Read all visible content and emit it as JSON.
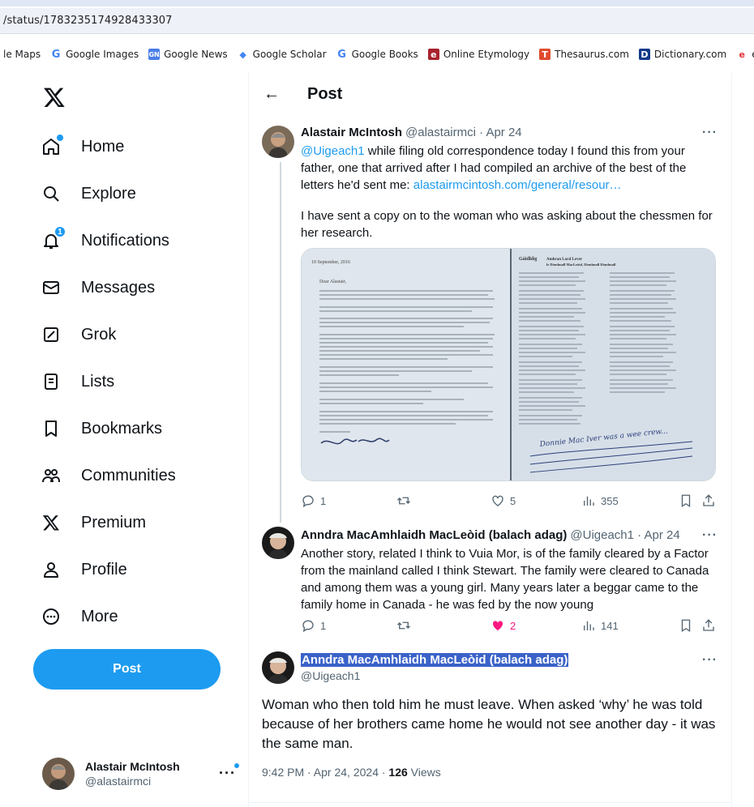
{
  "browser": {
    "url": "/status/1783235174928433307",
    "bookmarks": [
      {
        "label": "le Maps",
        "icon": "none"
      },
      {
        "label": "Google Images",
        "icon": "google-icon"
      },
      {
        "label": "Google News",
        "icon": "google-news-icon"
      },
      {
        "label": "Google Scholar",
        "icon": "google-scholar-icon"
      },
      {
        "label": "Google Books",
        "icon": "google-icon"
      },
      {
        "label": "Online Etymology",
        "icon": "etymology-icon"
      },
      {
        "label": "Thesaurus.com",
        "icon": "thesaurus-icon"
      },
      {
        "label": "Dictionary.com",
        "icon": "dictionary-icon"
      },
      {
        "label": "eBay",
        "icon": "ebay-icon"
      }
    ]
  },
  "nav": {
    "items": [
      {
        "label": "Home",
        "icon": "home-icon"
      },
      {
        "label": "Explore",
        "icon": "search-icon"
      },
      {
        "label": "Notifications",
        "icon": "bell-icon",
        "badge": "1"
      },
      {
        "label": "Messages",
        "icon": "envelope-icon"
      },
      {
        "label": "Grok",
        "icon": "grok-icon"
      },
      {
        "label": "Lists",
        "icon": "list-icon"
      },
      {
        "label": "Bookmarks",
        "icon": "bookmark-icon"
      },
      {
        "label": "Communities",
        "icon": "communities-icon"
      },
      {
        "label": "Premium",
        "icon": "x-logo-icon"
      },
      {
        "label": "Profile",
        "icon": "person-icon"
      },
      {
        "label": "More",
        "icon": "more-circle-icon"
      }
    ],
    "post_button": "Post"
  },
  "account": {
    "name": "Alastair McIntosh",
    "handle": "@alastairmci",
    "more": "···"
  },
  "header": {
    "title": "Post"
  },
  "tweet1": {
    "name": "Alastair McIntosh",
    "meta": "@alastairmci · Apr 24",
    "mention": "@Uigeach1",
    "text_a": " while filing old correspondence today I found this from your father, one that arrived after I had compiled an archive of the best of the letters he'd sent me: ",
    "link": "alastairmcintosh.com/general/resour…",
    "text_b": "I have sent a copy on to the woman who was asking about the chessmen for her research.",
    "replies": "1",
    "likes": "5",
    "views": "355",
    "media_left_date": "10 September, 2016",
    "media_left_greeting": "Dear Alastair,",
    "media_right_title": "Gàidhlig",
    "media_right_heading": "Amhran Lord Lever",
    "media_right_sub": "le Dòmhnall MacLeòid, Dòmhnall Dòmhnall",
    "media_handwriting": "Donnie Mac Iver was a wee crew..."
  },
  "tweet2": {
    "name": "Anndra MacAmhlaidh MacLeòid (balach adag)",
    "meta": "@Uigeach1 · Apr 24",
    "text": "Another story, related I think to Vuia Mor,  is of the family cleared by a Factor from the mainland called I think Stewart. The family were cleared to Canada and among them was a young girl. Many years later a beggar came to the family home in Canada - he was fed by the now young",
    "replies": "1",
    "likes": "2",
    "views": "141",
    "like_color": "#f91880"
  },
  "focus": {
    "name": "Anndra MacAmhlaidh MacLeòid (balach adag)",
    "handle": "@Uigeach1",
    "text": "Woman who then told him he must leave. When asked ‘why’ he was told because of her brothers came home he would not see another day - it was the same man.",
    "time": "9:42 PM · Apr 24, 2024 · ",
    "views_count": "126",
    "views_label": " Views"
  },
  "colors": {
    "accent": "#1d9bf0",
    "text_secondary": "#536471",
    "selection": "#3a62c9"
  }
}
